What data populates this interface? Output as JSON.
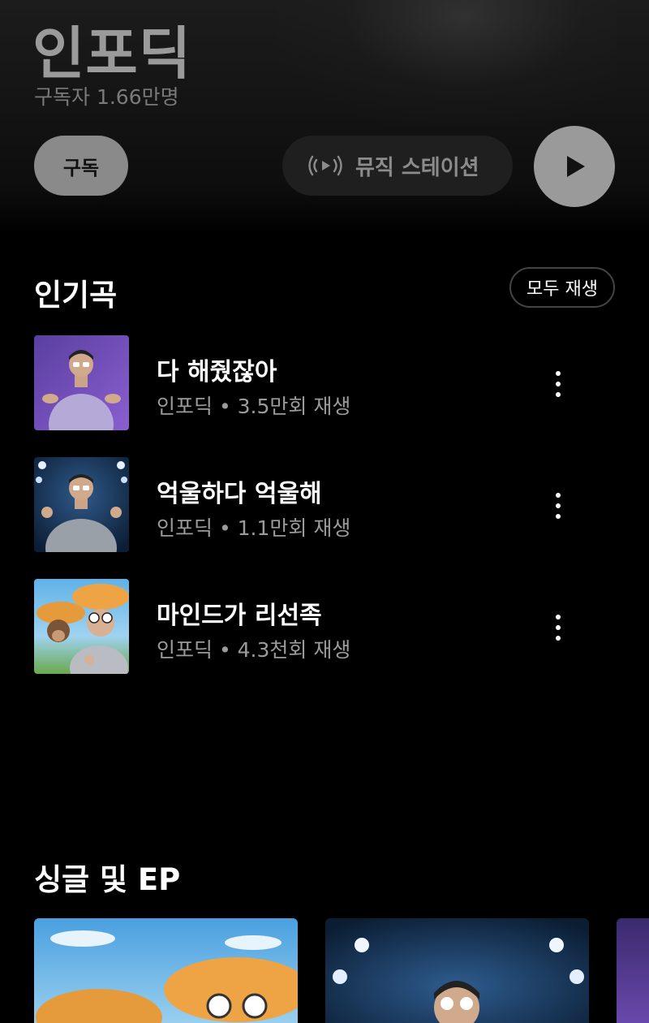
{
  "artist": {
    "name": "인포딕",
    "subscribers": "구독자 1.66만명"
  },
  "actions": {
    "subscribe_label": "구독",
    "station_label": "뮤직 스테이션",
    "station_icon": "radio-play-icon",
    "play_icon": "play-icon"
  },
  "popular": {
    "title": "인기곡",
    "play_all_label": "모두 재생",
    "tracks": [
      {
        "title": "다 해줬잖아",
        "meta": "인포딕 • 3.5만회 재생"
      },
      {
        "title": "억울하다 억울해",
        "meta": "인포딕 • 1.1만회 재생"
      },
      {
        "title": "마인드가 리선족",
        "meta": "인포딕 • 4.3천회 재생"
      }
    ]
  },
  "singles": {
    "title": "싱글 및 EP"
  },
  "colors": {
    "background": "#000000",
    "subscribe_bg": "#8a8a8a",
    "station_bg": "#1f1f1f",
    "meta_text": "#9b9b9b"
  }
}
